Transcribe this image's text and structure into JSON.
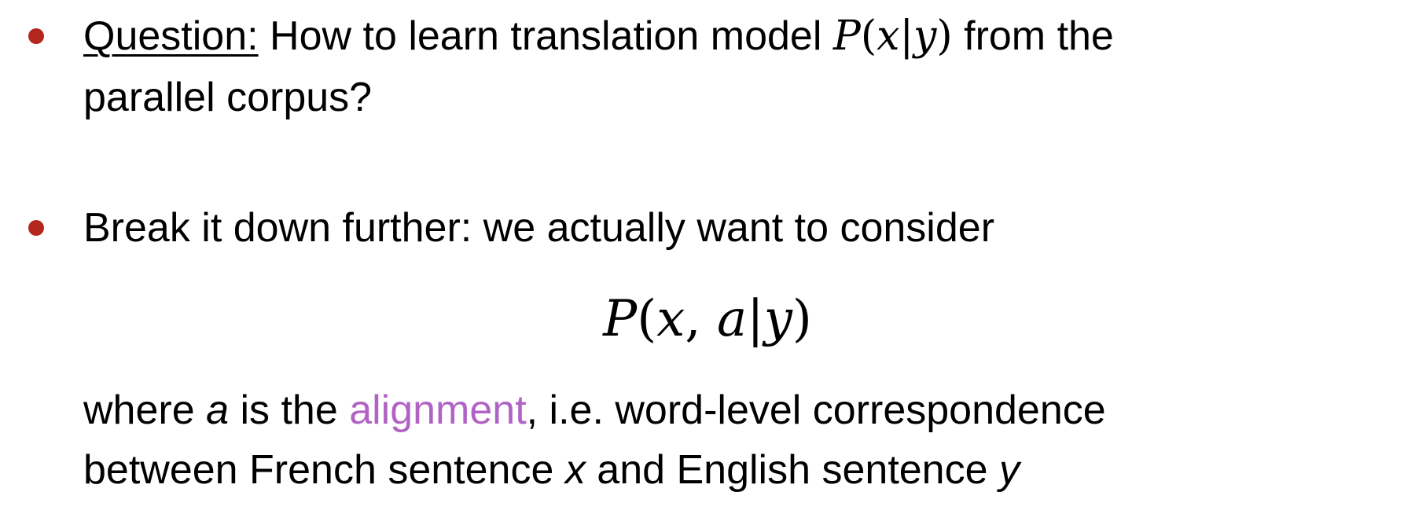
{
  "bullet1": {
    "label": "Question:",
    "text_pre": " How to learn translation model ",
    "math": {
      "P": "P",
      "open": "(",
      "x": "x",
      "bar": "|",
      "y": "y",
      "close": ")"
    },
    "text_post": " from the",
    "line2": "parallel corpus?"
  },
  "bullet2": {
    "text": "Break it down further: we actually want to consider"
  },
  "formula": {
    "P": "P",
    "open": "(",
    "x": "x",
    "comma": ",",
    "a": "a",
    "bar": "|",
    "y": "y",
    "close": ")"
  },
  "explanation": {
    "line1": {
      "t1": "where ",
      "var_a": "a",
      "t2": " is the ",
      "term": "alignment",
      "t3": ", i.e. word-level correspondence"
    },
    "line2": {
      "t1": "between French sentence ",
      "var_x": "x",
      "t2": " and English sentence ",
      "var_y": "y"
    }
  },
  "colors": {
    "bullet": "#b5261e",
    "accent": "#b063c4",
    "text": "#000000"
  }
}
